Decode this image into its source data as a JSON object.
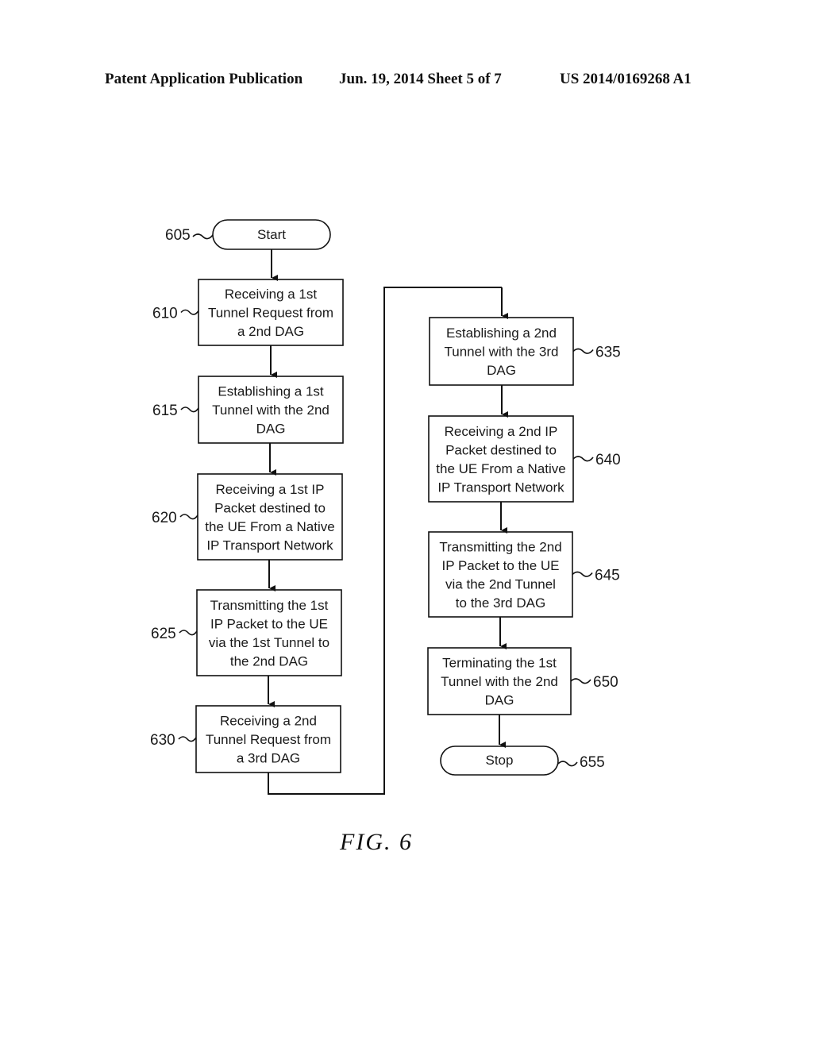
{
  "header": {
    "publication": "Patent Application Publication",
    "date_sheet": "Jun. 19, 2014  Sheet 5 of 7",
    "number": "US 2014/0169268 A1"
  },
  "figure_label": "FIG.  6",
  "flowchart": {
    "start": {
      "ref": "605",
      "label": "Start"
    },
    "stop": {
      "ref": "655",
      "label": "Stop"
    },
    "steps": [
      {
        "ref": "610",
        "lines": [
          "Receiving a 1st",
          "Tunnel Request from",
          "a 2nd DAG"
        ]
      },
      {
        "ref": "615",
        "lines": [
          "Establishing a 1st",
          "Tunnel with the 2nd",
          "DAG"
        ]
      },
      {
        "ref": "620",
        "lines": [
          "Receiving a 1st IP",
          "Packet destined to",
          "the UE From a Native",
          "IP Transport Network"
        ]
      },
      {
        "ref": "625",
        "lines": [
          "Transmitting the 1st",
          "IP Packet to the UE",
          "via the 1st Tunnel to",
          "the 2nd DAG"
        ]
      },
      {
        "ref": "630",
        "lines": [
          "Receiving a 2nd",
          "Tunnel Request from",
          "a 3rd DAG"
        ]
      },
      {
        "ref": "635",
        "lines": [
          "Establishing a 2nd",
          "Tunnel with the 3rd",
          "DAG"
        ]
      },
      {
        "ref": "640",
        "lines": [
          "Receiving a 2nd IP",
          "Packet destined to",
          "the UE From a Native",
          "IP Transport Network"
        ]
      },
      {
        "ref": "645",
        "lines": [
          "Transmitting the 2nd",
          "IP Packet to the UE",
          "via the 2nd Tunnel",
          "to the 3rd DAG"
        ]
      },
      {
        "ref": "650",
        "lines": [
          "Terminating the 1st",
          "Tunnel with the 2nd",
          "DAG"
        ]
      }
    ]
  }
}
